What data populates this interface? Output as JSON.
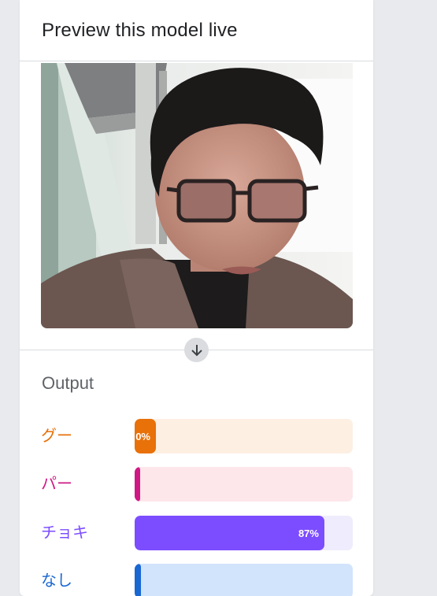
{
  "panel": {
    "title": "Preview this model live"
  },
  "preview": {
    "description_icon": "webcam-preview"
  },
  "output": {
    "title": "Output",
    "classes": [
      {
        "label": "グー",
        "percent": 0,
        "display": "0%",
        "color": "#e8710a",
        "track": "#feefe3"
      },
      {
        "label": "パー",
        "percent": 0,
        "display": "",
        "color": "#d01884",
        "track": "#fde7ea"
      },
      {
        "label": "チョキ",
        "percent": 87,
        "display": "87%",
        "color": "#7c4dff",
        "track": "#efecfd"
      },
      {
        "label": "なし",
        "percent": 1,
        "display": "",
        "color": "#1967d2",
        "track": "#d2e3fc"
      }
    ]
  },
  "icons": {
    "divider_arrow": "arrow-down-icon"
  }
}
